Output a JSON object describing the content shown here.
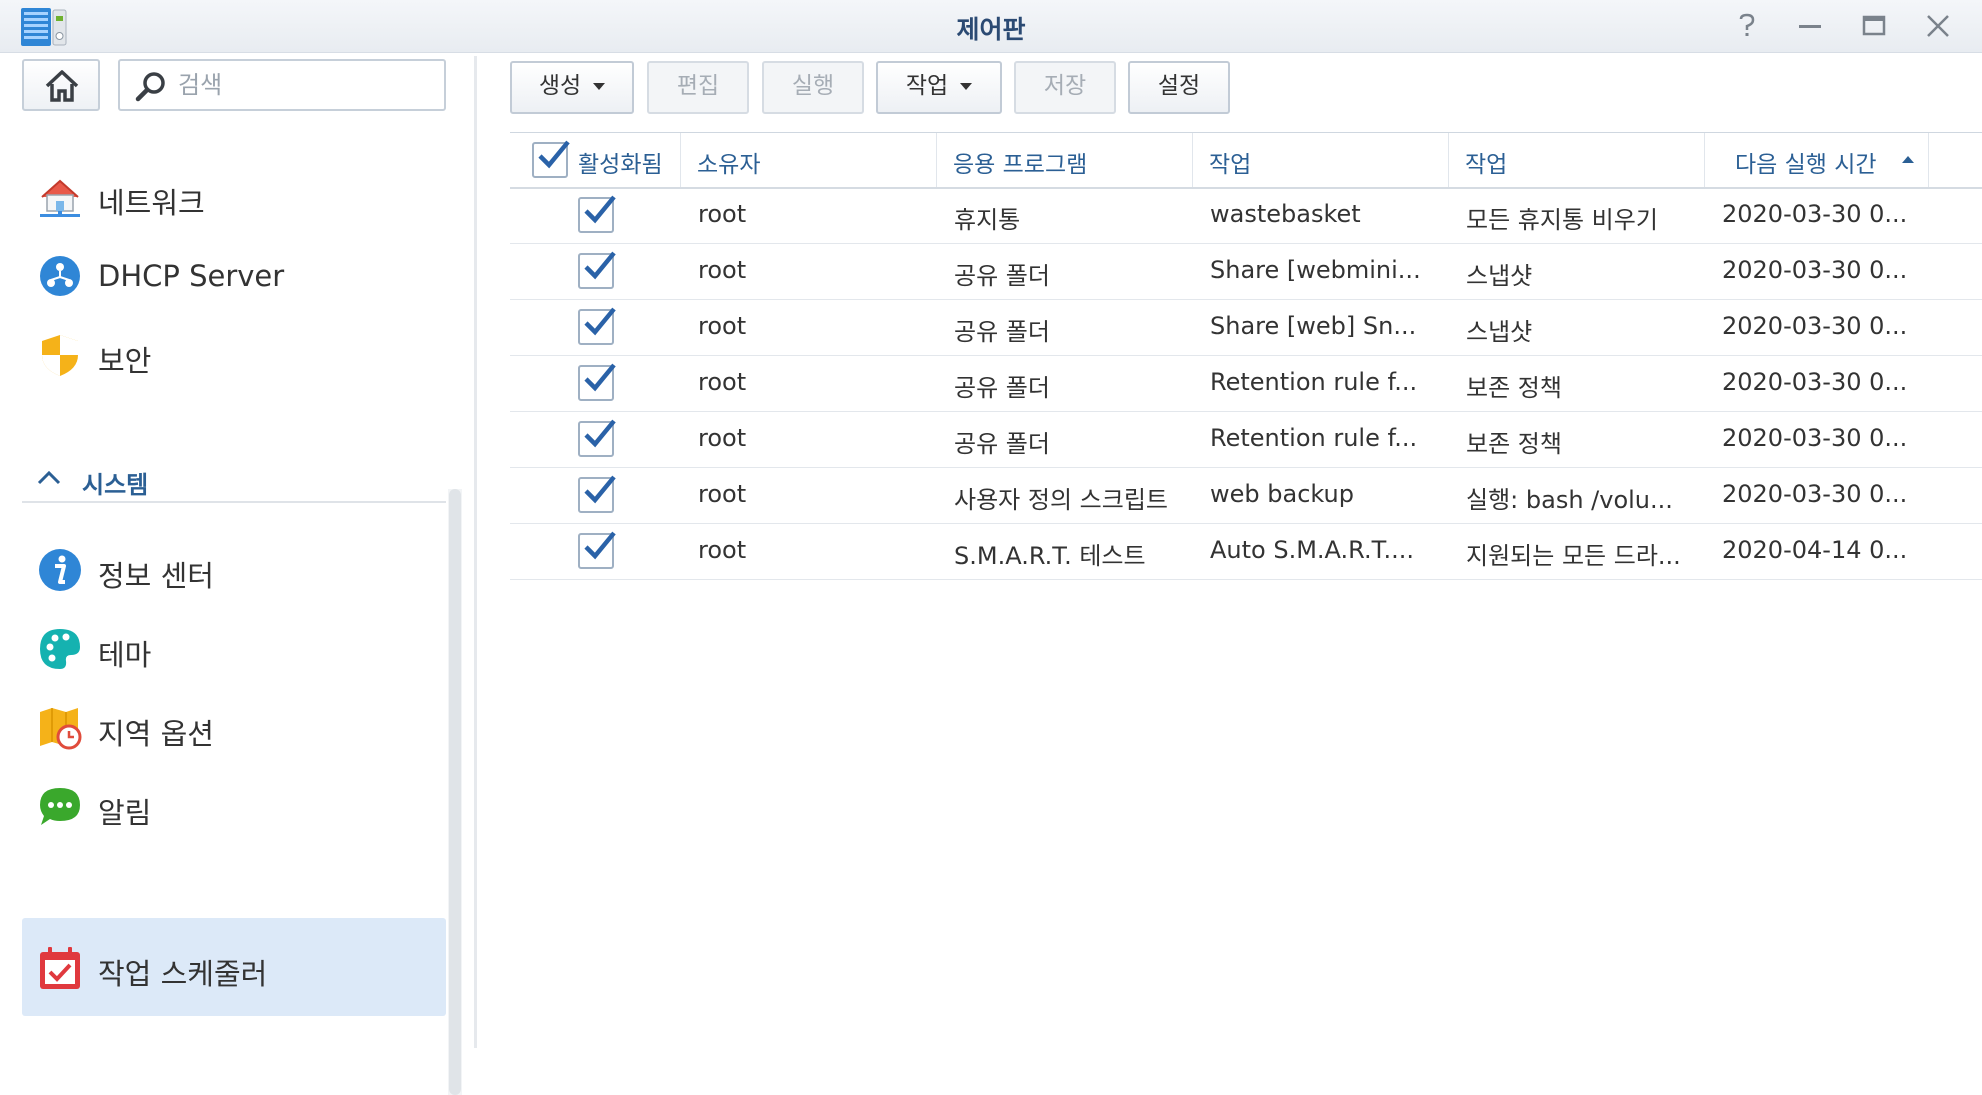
{
  "window": {
    "title": "제어판",
    "icons": {
      "app": "control-panel-icon",
      "help": "help-icon",
      "minimize": "minimize-icon",
      "maximize": "maximize-icon",
      "close": "close-icon"
    }
  },
  "sidebar": {
    "search_placeholder": "검색",
    "items": [
      {
        "label": "네트워크",
        "icon": "network-icon"
      },
      {
        "label": "DHCP Server",
        "icon": "dhcp-server-icon"
      },
      {
        "label": "보안",
        "icon": "shield-icon"
      }
    ],
    "section": {
      "label": "시스템",
      "expanded": true
    },
    "system_items": [
      {
        "label": "정보 센터",
        "icon": "info-icon"
      },
      {
        "label": "테마",
        "icon": "palette-icon"
      },
      {
        "label": "지역 옵션",
        "icon": "regional-options-icon"
      },
      {
        "label": "알림",
        "icon": "chat-bubble-icon"
      },
      {
        "label": "작업 스케줄러",
        "icon": "calendar-check-icon",
        "selected": true
      }
    ]
  },
  "toolbar": {
    "create": "생성",
    "edit": "편집",
    "run": "실행",
    "action": "작업",
    "save": "저장",
    "settings": "설정",
    "disabled": [
      "edit",
      "run",
      "save"
    ]
  },
  "colors": {
    "accent": "#2b5f94",
    "selected_bg": "#dce9f8",
    "check": "#2a62a8"
  },
  "grid": {
    "columns": [
      "활성화됨",
      "소유자",
      "응용 프로그램",
      "작업",
      "작업",
      "다음 실행 시간"
    ],
    "sorted_column": 5,
    "sort_direction": "ascending",
    "header_checked": true,
    "rows": [
      {
        "enabled": true,
        "owner": "root",
        "app": "휴지통",
        "task": "wastebasket",
        "action": "모든 휴지통 비우기",
        "next_run": "2020-03-30 0..."
      },
      {
        "enabled": true,
        "owner": "root",
        "app": "공유 폴더",
        "task": "Share [webmini...",
        "action": "스냅샷",
        "next_run": "2020-03-30 0..."
      },
      {
        "enabled": true,
        "owner": "root",
        "app": "공유 폴더",
        "task": "Share [web] Sn...",
        "action": "스냅샷",
        "next_run": "2020-03-30 0..."
      },
      {
        "enabled": true,
        "owner": "root",
        "app": "공유 폴더",
        "task": "Retention rule f...",
        "action": "보존 정책",
        "next_run": "2020-03-30 0..."
      },
      {
        "enabled": true,
        "owner": "root",
        "app": "공유 폴더",
        "task": "Retention rule f...",
        "action": "보존 정책",
        "next_run": "2020-03-30 0..."
      },
      {
        "enabled": true,
        "owner": "root",
        "app": "사용자 정의 스크립트",
        "task": "web backup",
        "action": "실행: bash /volu...",
        "next_run": "2020-03-30 0..."
      },
      {
        "enabled": true,
        "owner": "root",
        "app": "S.M.A.R.T. 테스트",
        "task": "Auto S.M.A.R.T....",
        "action": "지원되는 모든 드라...",
        "next_run": "2020-04-14 0..."
      }
    ]
  }
}
